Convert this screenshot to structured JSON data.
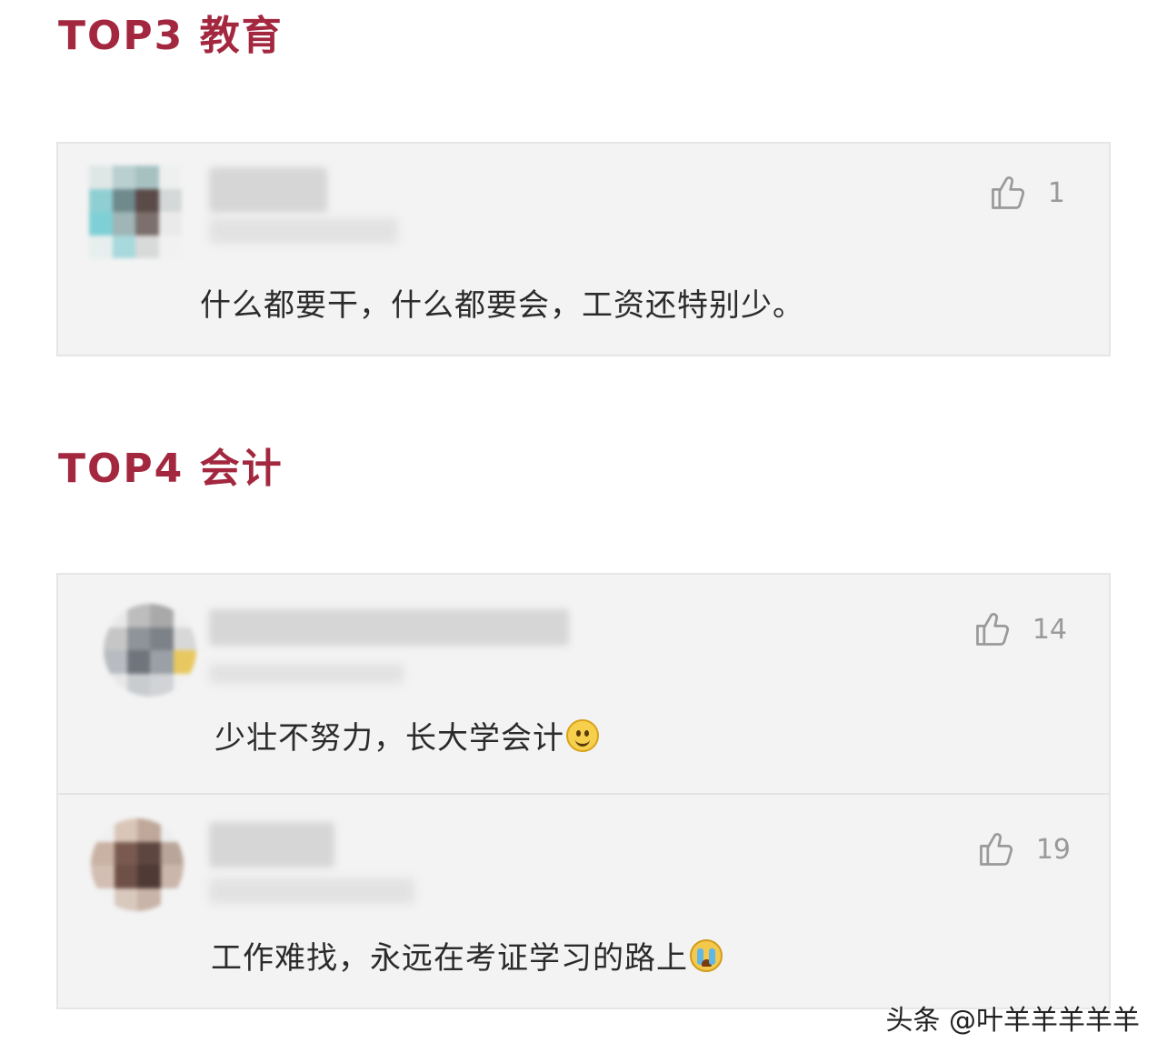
{
  "sections": [
    {
      "title": "TOP3 教育",
      "comments": [
        {
          "likes": "1",
          "text": "什么都要干，什么都要会，工资还特别少。",
          "emoji": null,
          "avatar_colors": [
            "#dfe6e6",
            "#b9cfd0",
            "#a7c1c3",
            "#eef0f0",
            "#8fcfd3",
            "#6f8a8c",
            "#5a4a48",
            "#d5d8d8",
            "#7fd0d6",
            "#9fb5b6",
            "#7c6f6c",
            "#eaeaea",
            "#e6eeee",
            "#a8d9dc",
            "#d8dada",
            "#f1f1f1"
          ]
        }
      ]
    },
    {
      "title": "TOP4 会计",
      "comments": [
        {
          "likes": "14",
          "text": "少壮不努力，长大学会计",
          "emoji": "smile-emoji",
          "avatar_colors": [
            "#e9e9e9",
            "#bdbdbd",
            "#a9a9a9",
            "#efefef",
            "#c6c6c6",
            "#8f949a",
            "#7d8288",
            "#d8d8d8",
            "#b8bcc0",
            "#6f757c",
            "#9aa0a6",
            "#e8c860",
            "#e7e7e7",
            "#c9cccf",
            "#d1d3d6",
            "#f0f0f0"
          ]
        },
        {
          "likes": "19",
          "text": "工作难找，永远在考证学习的路上",
          "emoji": "crying-emoji",
          "avatar_colors": [
            "#efefef",
            "#d9c6b8",
            "#bfa89a",
            "#eeeeee",
            "#c9b1a3",
            "#7a5a50",
            "#5e4640",
            "#b9a59a",
            "#d2beb2",
            "#6e5048",
            "#4f3a35",
            "#cab6aa",
            "#f1f1f1",
            "#d8c8be",
            "#c8b4a8",
            "#f2f2f2"
          ]
        }
      ]
    }
  ],
  "watermark": "头条 @叶羊羊羊羊羊"
}
